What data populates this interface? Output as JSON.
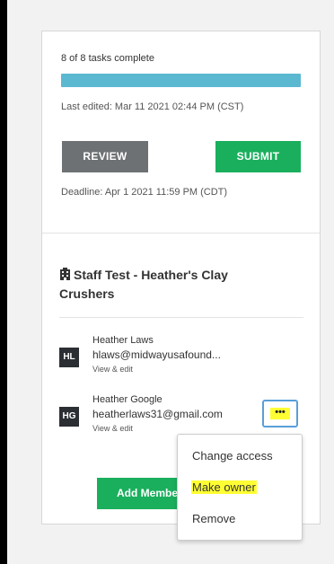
{
  "progress": {
    "tasks_text": "8 of 8 tasks complete",
    "fraction": 1.0,
    "color": "#5bb8d1",
    "last_edited": "Last edited: Mar 11 2021 02:44 PM (CST)"
  },
  "actions": {
    "review_label": "REVIEW",
    "submit_label": "SUBMIT",
    "deadline": "Deadline: Apr 1 2021 11:59 PM (CDT)"
  },
  "team": {
    "icon": "building-icon",
    "name": "Staff Test - Heather's Clay Crushers"
  },
  "members": [
    {
      "initials": "HL",
      "name": "Heather Laws",
      "email": "hlaws@midwayusafound...",
      "link": "View & edit"
    },
    {
      "initials": "HG",
      "name": "Heather Google",
      "email": "heatherlaws31@gmail.com",
      "link": "View & edit"
    }
  ],
  "more_button": {
    "label": "•••",
    "highlight": "#ffff33"
  },
  "add_member_label": "Add Member",
  "menu": {
    "items": [
      {
        "label": "Change access",
        "highlighted": false
      },
      {
        "label": "Make owner",
        "highlighted": true
      },
      {
        "label": "Remove",
        "highlighted": false
      }
    ]
  },
  "colors": {
    "green": "#1aaf5d",
    "gray_button": "#6d7174",
    "focus_blue": "#5a9fd8"
  }
}
